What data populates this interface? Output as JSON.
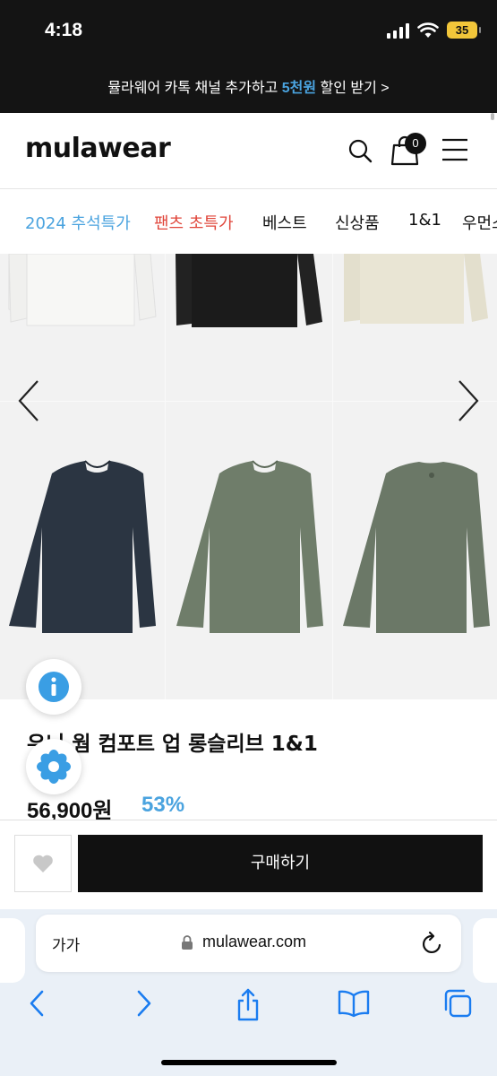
{
  "status_bar": {
    "time": "4:18",
    "battery": "35"
  },
  "promo": {
    "prefix": "뮬라웨어 카톡 채널 추가하고 ",
    "highlight": "5천원",
    "suffix": " 할인 받기 >"
  },
  "header": {
    "logo": "mulawear",
    "cart_count": "0"
  },
  "nav": {
    "items": [
      {
        "label": "2024 추석특가",
        "color": "#4aa3df"
      },
      {
        "label": "팬츠 초특가",
        "color": "#e0453a"
      },
      {
        "label": "베스트",
        "color": "#111111"
      },
      {
        "label": "신상품",
        "color": "#111111"
      },
      {
        "label": "1&1",
        "color": "#111111"
      },
      {
        "label": "우먼스",
        "color": "#111111"
      }
    ]
  },
  "gallery": {
    "colors": {
      "white": "#f4f4f2",
      "black": "#1a1a1a",
      "beige": "#e8e4d3",
      "navy": "#2b3542",
      "khaki": "#6f7d6a",
      "khaki_back": "#6b7867"
    }
  },
  "product": {
    "title": "우니 웜 컴포트 업 롱슬리브 1&1",
    "original_price": "",
    "price": "56,900원",
    "discount": "53%"
  },
  "buy_bar": {
    "buy_label": "구매하기"
  },
  "browser": {
    "text_size": "가가",
    "url": "mulawear.com"
  }
}
